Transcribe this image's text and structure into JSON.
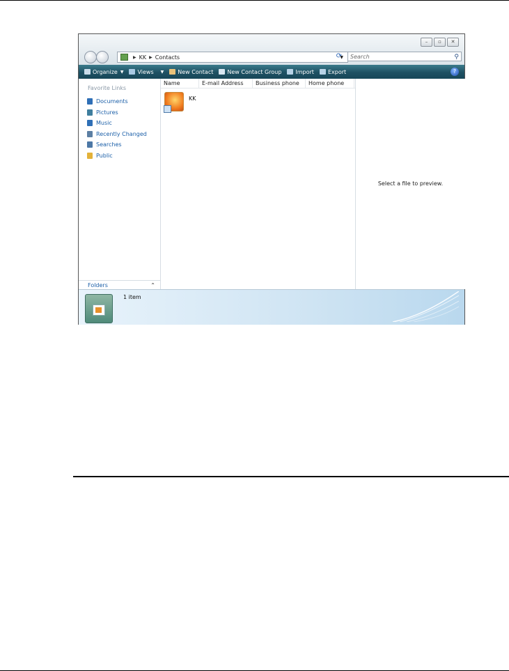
{
  "window": {
    "controls": [
      "–",
      "▫",
      "✕"
    ],
    "address": {
      "parts": [
        "KK",
        "Contacts"
      ]
    },
    "search_placeholder": "Search",
    "toolbar": [
      {
        "label": "Organize",
        "icon": "organize-icon",
        "caret": true
      },
      {
        "label": "Views",
        "icon": "views-icon",
        "caret": true
      },
      {
        "label": "New Contact",
        "icon": "new-contact-icon",
        "caret": false
      },
      {
        "label": "New Contact Group",
        "icon": "new-contact-group-icon",
        "caret": false
      },
      {
        "label": "Import",
        "icon": "import-icon",
        "caret": false
      },
      {
        "label": "Export",
        "icon": "export-icon",
        "caret": false
      }
    ],
    "help": "?",
    "nav": {
      "title": "Favorite Links",
      "links": [
        {
          "label": "Documents",
          "icon": "documents-icon",
          "color": "#2f6fb6"
        },
        {
          "label": "Pictures",
          "icon": "pictures-icon",
          "color": "#3f7e9e"
        },
        {
          "label": "Music",
          "icon": "music-icon",
          "color": "#2f6fb6"
        },
        {
          "label": "Recently Changed",
          "icon": "recent-icon",
          "color": "#5c7fa3"
        },
        {
          "label": "Searches",
          "icon": "searches-icon",
          "color": "#4d78a6"
        },
        {
          "label": "Public",
          "icon": "public-icon",
          "color": "#e3b23a"
        }
      ],
      "folders_label": "Folders"
    },
    "columns": [
      "Name",
      "E-mail Address",
      "Business phone",
      "Home phone"
    ],
    "items": [
      {
        "name": "KK"
      }
    ],
    "preview_text": "Select a file to preview.",
    "status": "1 item"
  },
  "colors": {
    "toolbar": "#1e5163",
    "link": "#1b5fa8"
  }
}
